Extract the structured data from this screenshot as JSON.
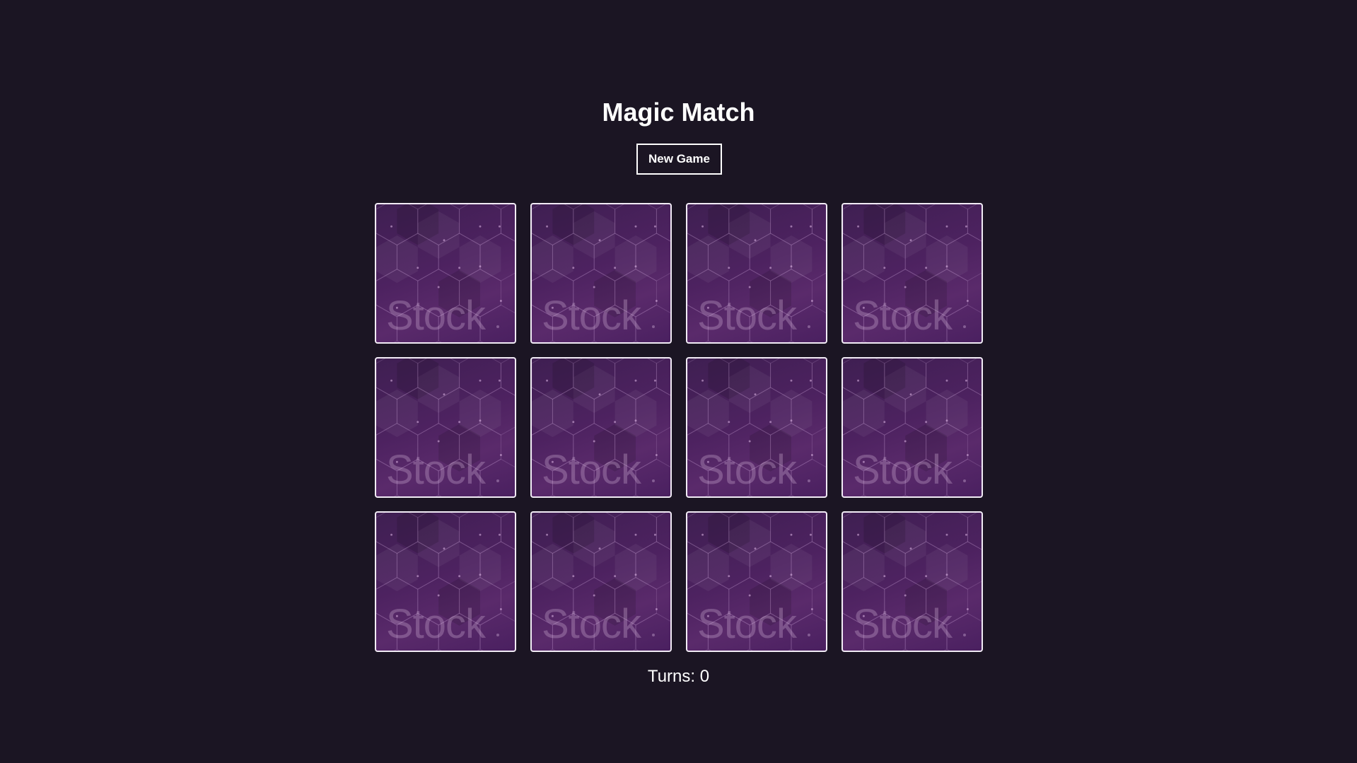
{
  "header": {
    "title": "Magic Match",
    "new_game_label": "New Game"
  },
  "board": {
    "rows": 3,
    "columns": 4,
    "card_back_watermark": "Stock",
    "cards": [
      {
        "face": "down"
      },
      {
        "face": "down"
      },
      {
        "face": "down"
      },
      {
        "face": "down"
      },
      {
        "face": "down"
      },
      {
        "face": "down"
      },
      {
        "face": "down"
      },
      {
        "face": "down"
      },
      {
        "face": "down"
      },
      {
        "face": "down"
      },
      {
        "face": "down"
      },
      {
        "face": "down"
      }
    ]
  },
  "status": {
    "turns_text": "Turns: 0"
  },
  "colors": {
    "background": "#1b1523",
    "card_back": "#4d2260",
    "card_border": "#f2ecf6",
    "text": "#ffffff"
  }
}
